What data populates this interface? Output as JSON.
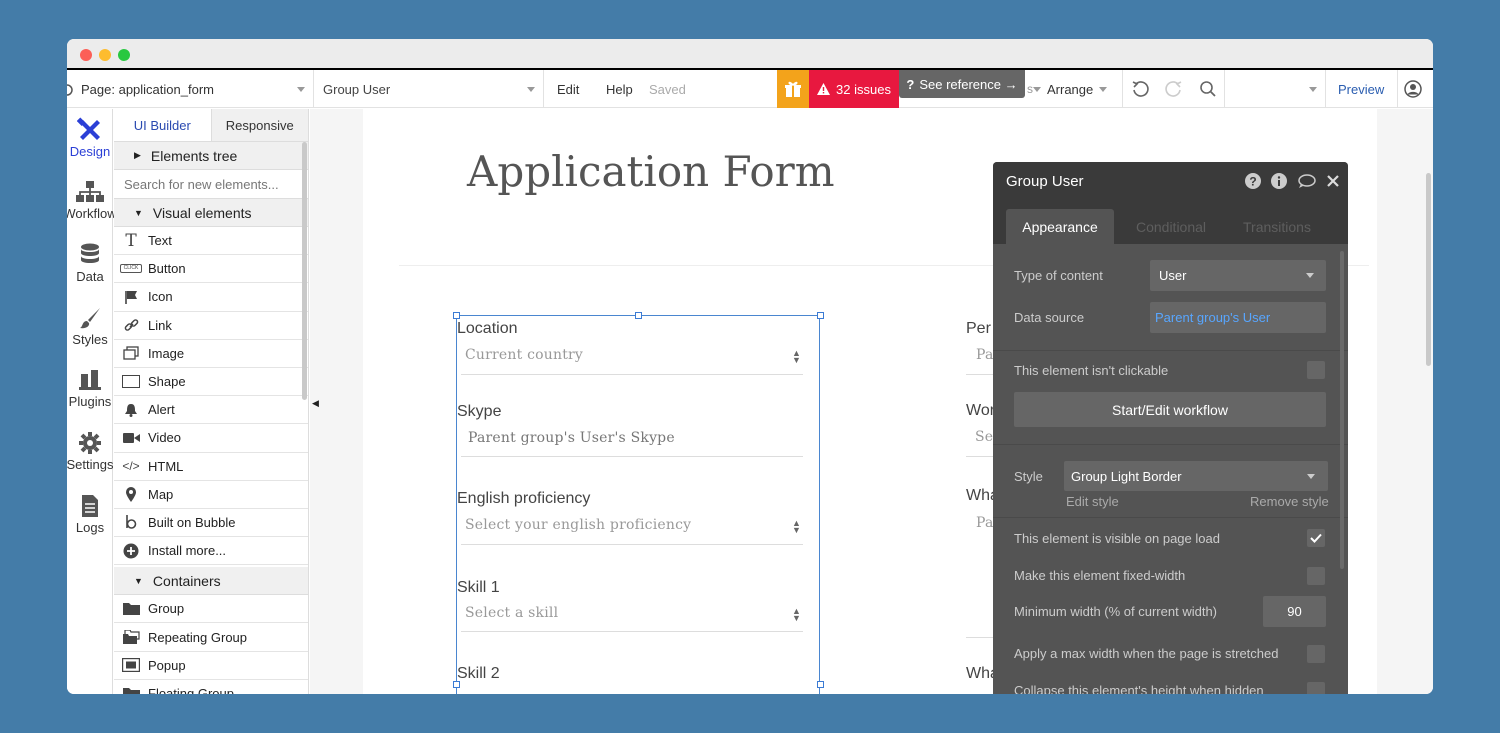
{
  "toolbar": {
    "page_select": "Page: application_form",
    "element_select": "Group User",
    "edit": "Edit",
    "help": "Help",
    "saved": "Saved",
    "issues": "32 issues",
    "see_reference": "See reference →",
    "arrange": "Arrange",
    "preview": "Preview"
  },
  "nav": [
    {
      "label": "Design",
      "icon": "design-icon"
    },
    {
      "label": "Workflow",
      "icon": "workflow-icon"
    },
    {
      "label": "Data",
      "icon": "data-icon"
    },
    {
      "label": "Styles",
      "icon": "styles-icon"
    },
    {
      "label": "Plugins",
      "icon": "plugins-icon"
    },
    {
      "label": "Settings",
      "icon": "settings-icon"
    },
    {
      "label": "Logs",
      "icon": "logs-icon"
    }
  ],
  "panel": {
    "tab_ui_builder": "UI Builder",
    "tab_responsive": "Responsive",
    "elements_tree": "Elements tree",
    "search_placeholder": "Search for new elements...",
    "visual_elements": "Visual elements",
    "visual_items": [
      {
        "label": "Text",
        "icon": "text-icon"
      },
      {
        "label": "Button",
        "icon": "button-icon"
      },
      {
        "label": "Icon",
        "icon": "flag-icon"
      },
      {
        "label": "Link",
        "icon": "link-icon"
      },
      {
        "label": "Image",
        "icon": "image-icon"
      },
      {
        "label": "Shape",
        "icon": "shape-icon"
      },
      {
        "label": "Alert",
        "icon": "bell-icon"
      },
      {
        "label": "Video",
        "icon": "video-icon"
      },
      {
        "label": "HTML",
        "icon": "code-icon"
      },
      {
        "label": "Map",
        "icon": "map-pin-icon"
      },
      {
        "label": "Built on Bubble",
        "icon": "bubble-logo-icon"
      },
      {
        "label": "Install more...",
        "icon": "plus-circle-icon"
      }
    ],
    "containers": "Containers",
    "container_items": [
      {
        "label": "Group",
        "icon": "folder-icon"
      },
      {
        "label": "Repeating Group",
        "icon": "repeating-group-icon"
      },
      {
        "label": "Popup",
        "icon": "popup-icon"
      },
      {
        "label": "Floating Group",
        "icon": "floating-group-icon"
      }
    ]
  },
  "canvas": {
    "title": "Application Form",
    "fields": [
      {
        "label": "Location",
        "value": "Current country"
      },
      {
        "label": "Skype",
        "value": "Parent group's User's Skype"
      },
      {
        "label": "English proficiency",
        "value": "Select your english proficiency"
      },
      {
        "label": "Skill 1",
        "value": "Select a skill"
      },
      {
        "label": "Skill 2",
        "value": ""
      }
    ],
    "right_labels": [
      "Per",
      "Wor",
      "Wha",
      "Wha"
    ],
    "right_values": [
      "Pa",
      "Se",
      "Pa"
    ]
  },
  "inspector": {
    "title": "Group User",
    "tab_appearance": "Appearance",
    "tab_conditional": "Conditional",
    "tab_transitions": "Transitions",
    "type_of_content_label": "Type of content",
    "type_of_content_value": "User",
    "data_source_label": "Data source",
    "data_source_value": "Parent group's User",
    "not_clickable_label": "This element isn't clickable",
    "workflow_button": "Start/Edit workflow",
    "style_label": "Style",
    "style_value": "Group Light Border",
    "edit_style": "Edit style",
    "remove_style": "Remove style",
    "visible_label": "This element is visible on page load",
    "fixed_width_label": "Make this element fixed-width",
    "min_width_label": "Minimum width (% of current width)",
    "min_width_value": "90",
    "max_width_label": "Apply a max width when the page is stretched",
    "collapse_label": "Collapse this element's height when hidden"
  }
}
